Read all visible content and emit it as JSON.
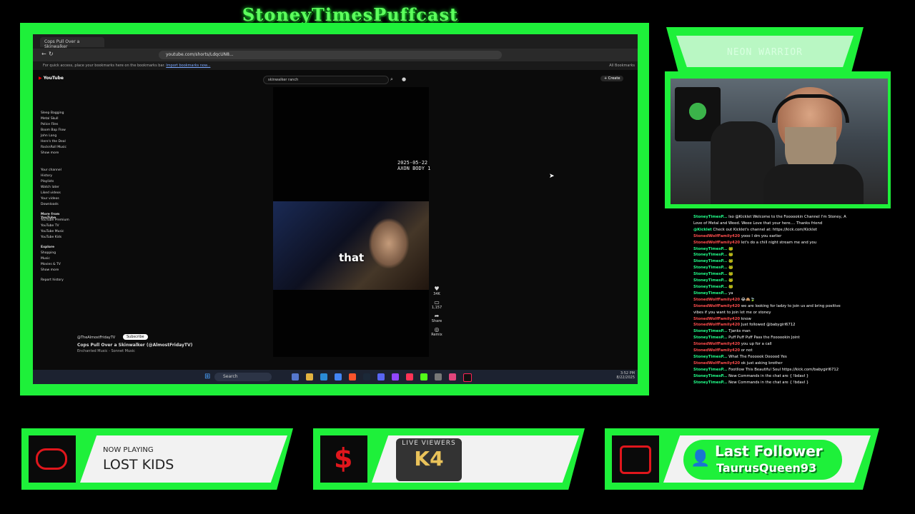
{
  "overlay": {
    "title": "StoneyTimesPuffcast",
    "cam_banner": "NEON WARRIOR"
  },
  "browser": {
    "tab_title": "Cops Pull Over a Skinwalker",
    "url": "youtube.com/shorts/LdqcUN8...",
    "bookmarks_text": "For quick access, place your bookmarks here on the bookmarks bar.",
    "bookmarks_link": "Import bookmarks now...",
    "all_bookmarks": "All Bookmarks"
  },
  "youtube": {
    "logo": "YouTube",
    "search_value": "skinwalker ranch",
    "create_label": "Create",
    "sidebar_subs": [
      "Sleep Bagging",
      "Metal Skull",
      "Police Files",
      "Boom Bap Flow",
      "John Lang",
      "Here's the Deal",
      "RocknRoll Music",
      "Show more"
    ],
    "sidebar_you": [
      "Your channel",
      "History",
      "Playlists",
      "Watch later",
      "Liked videos",
      "Your videos",
      "Downloads"
    ],
    "more_header": "More from YouTube",
    "sidebar_more": [
      "YouTube Premium",
      "YouTube TV",
      "YouTube Music",
      "YouTube Kids"
    ],
    "explore_header": "Explore",
    "sidebar_explore": [
      "Shopping",
      "Music",
      "Movies & TV",
      "Show more"
    ],
    "report": "Report history",
    "channel": "@TheAlmostFridayTV",
    "subscribe": "Subscribe",
    "video_title": "Cops Pull Over a Skinwalker (@AlmostFridayTV)",
    "audio": "Enchanted Music - Sonnet Music",
    "caption": "that",
    "timestamp_line1": "2025-05-22",
    "timestamp_line2": "AXON BODY 1",
    "likes": "34K",
    "comments": "1,157",
    "share": "Share",
    "remix": "Remix"
  },
  "taskbar": {
    "search": "Search",
    "time": "3:52 PM",
    "date": "8/22/2025"
  },
  "chat": [
    {
      "user": "StoneyTimesP...",
      "type": "streamer",
      "msg": "Iso @Kicklet Welcome to the Foooookin Channel I'm Stoney, A Love of Metal and Weed. Weee Love that your here.... Thanks friend"
    },
    {
      "user": "@Kicklet",
      "type": "streamer",
      "msg": "Check out Kicklet's channel at: https://kick.com/Kicklet"
    },
    {
      "user": "StonedWolfFamily420",
      "type": "viewer",
      "msg": "yooo I dm you earlier"
    },
    {
      "user": "StonedWolfFamily420",
      "type": "viewer",
      "msg": "let's do a chill night stream me and you"
    },
    {
      "user": "StoneyTimesP...",
      "type": "streamer",
      "msg": "🐸"
    },
    {
      "user": "StoneyTimesP...",
      "type": "streamer",
      "msg": "🐸"
    },
    {
      "user": "StoneyTimesP...",
      "type": "streamer",
      "msg": "🐸"
    },
    {
      "user": "StoneyTimesP...",
      "type": "streamer",
      "msg": "🐸"
    },
    {
      "user": "StoneyTimesP...",
      "type": "streamer",
      "msg": "🐸"
    },
    {
      "user": "StoneyTimesP...",
      "type": "streamer",
      "msg": "🐸"
    },
    {
      "user": "StoneyTimesP...",
      "type": "streamer",
      "msg": "🐸"
    },
    {
      "user": "StoneyTimesP...",
      "type": "streamer",
      "msg": "ya"
    },
    {
      "user": "StonedWolfFamily420",
      "type": "viewer",
      "msg": "😂🙈🍃"
    },
    {
      "user": "StonedWolfFamily420",
      "type": "viewer",
      "msg": "we are looking for ladzy to join us and bring positive vibes if you want to join let me or stoney"
    },
    {
      "user": "StonedWolfFamily420",
      "type": "viewer",
      "msg": "know"
    },
    {
      "user": "StonedWolfFamily420",
      "type": "viewer",
      "msg": "Just followed @babygirl6712"
    },
    {
      "user": "StoneyTimesP...",
      "type": "streamer",
      "msg": "Tjanks man"
    },
    {
      "user": "StoneyTimesP...",
      "type": "streamer",
      "msg": "Puff Puff Puff Pass the Foooookin Joint"
    },
    {
      "user": "StonedWolfFamily420",
      "type": "viewer",
      "msg": "you up for a call"
    },
    {
      "user": "StonedWolfFamily420",
      "type": "viewer",
      "msg": "or not"
    },
    {
      "user": "StoneyTimesP...",
      "type": "streamer",
      "msg": "What The Foooook Dooood Yes"
    },
    {
      "user": "StonedWolfFamily420",
      "type": "viewer",
      "msg": "ok just asking brother"
    },
    {
      "user": "StoneyTimesP...",
      "type": "streamer",
      "msg": "Footllow This Beautiful Soul https://kick.com/babygirl6712"
    },
    {
      "user": "StoneyTimesP...",
      "type": "streamer",
      "msg": "New Commands in the chat are { !bdavl }"
    },
    {
      "user": "StoneyTimesP...",
      "type": "streamer",
      "msg": "New Commands in the chat are { !bdavl }"
    }
  ],
  "panels": {
    "now_playing_label": "NOW PLAYING",
    "now_playing_title": "LOST KIDS",
    "live_viewers_label": "LIVE VIEWERS",
    "live_viewers_value": "K4",
    "last_follower_label": "Last Follower",
    "last_follower_name": "TaurusQueen93"
  },
  "colors": {
    "neon": "#1ef03a",
    "panel_icon_red": "#e0161c",
    "chat_streamer": "#22ff8a",
    "chat_viewer": "#ff4d4d"
  }
}
